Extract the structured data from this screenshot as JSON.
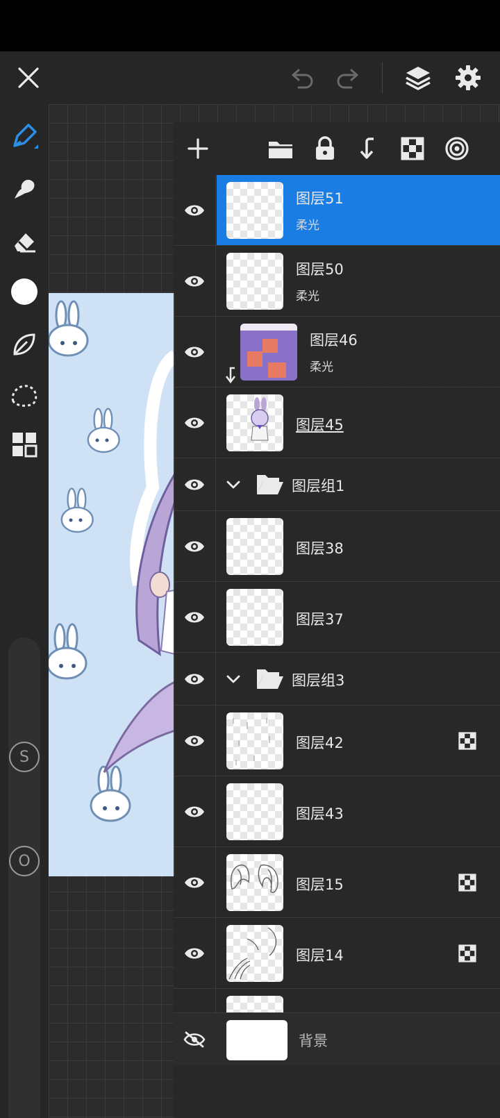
{
  "layers_panel": {
    "rows": [
      {
        "kind": "layer",
        "name": "图层51",
        "mode": "柔光",
        "selected": true,
        "clipped": false,
        "alpha_lock": false
      },
      {
        "kind": "layer",
        "name": "图层50",
        "mode": "柔光",
        "selected": false,
        "clipped": false,
        "alpha_lock": false
      },
      {
        "kind": "layer",
        "name": "图层46",
        "mode": "柔光",
        "selected": false,
        "clipped": true,
        "alpha_lock": false
      },
      {
        "kind": "layer",
        "name": "图层45",
        "mode": "",
        "selected": false,
        "clipped": false,
        "alpha_lock": false
      },
      {
        "kind": "group",
        "name": "图层组1"
      },
      {
        "kind": "layer",
        "name": "图层38",
        "mode": "",
        "selected": false,
        "clipped": false,
        "alpha_lock": false
      },
      {
        "kind": "layer",
        "name": "图层37",
        "mode": "",
        "selected": false,
        "clipped": false,
        "alpha_lock": false
      },
      {
        "kind": "group",
        "name": "图层组3"
      },
      {
        "kind": "layer",
        "name": "图层42",
        "mode": "",
        "selected": false,
        "clipped": false,
        "alpha_lock": true
      },
      {
        "kind": "layer",
        "name": "图层43",
        "mode": "",
        "selected": false,
        "clipped": false,
        "alpha_lock": false
      },
      {
        "kind": "layer",
        "name": "图层15",
        "mode": "",
        "selected": false,
        "clipped": false,
        "alpha_lock": true
      },
      {
        "kind": "layer",
        "name": "图层14",
        "mode": "",
        "selected": false,
        "clipped": false,
        "alpha_lock": true
      }
    ],
    "background_layer": {
      "name": "背景",
      "visible": false
    }
  },
  "sliders": {
    "size_badge": "S",
    "opacity_badge": "O"
  },
  "colors": {
    "accent": "#1a7de4",
    "panel": "#282828",
    "toolbar": "#262626"
  },
  "icons": {
    "top_bar": [
      "close-icon",
      "undo-icon",
      "redo-icon",
      "layers-icon",
      "gear-icon"
    ],
    "tools": [
      "pen-icon",
      "smudge-icon",
      "eraser-icon",
      "color-icon",
      "leaf-icon",
      "lasso-icon",
      "grid-icon"
    ],
    "panel_toolbar": [
      "add-icon",
      "folder-icon",
      "lock-icon",
      "merge-down-icon",
      "checker-icon",
      "target-icon"
    ]
  }
}
